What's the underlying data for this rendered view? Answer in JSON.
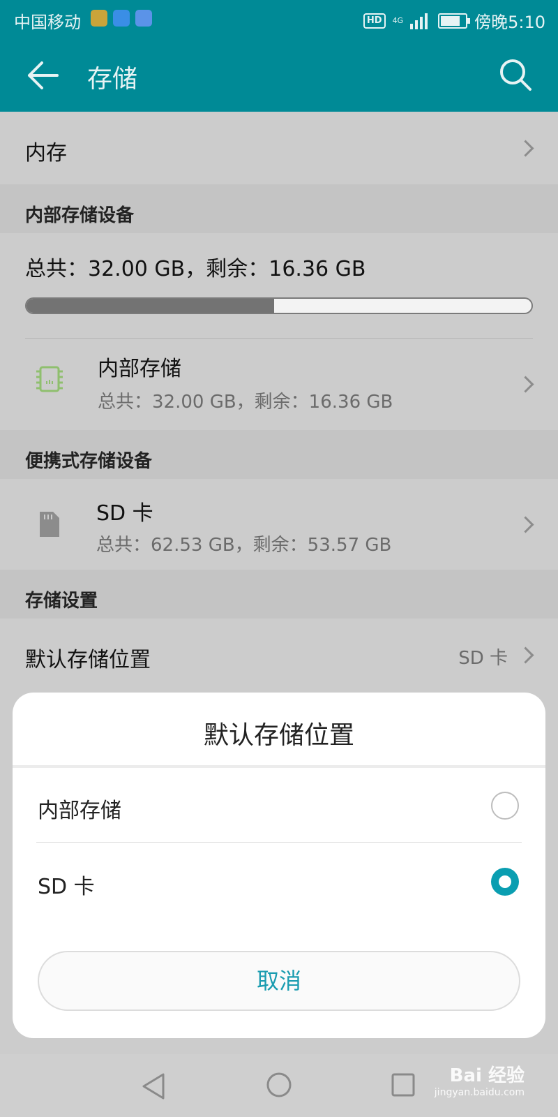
{
  "status_bar": {
    "carrier": "中国移动",
    "network": "4G",
    "hd_badge": "HD",
    "time": "傍晚5:10",
    "battery_level": 0.9
  },
  "app_bar": {
    "title": "存储",
    "back_icon": "arrow-left-icon",
    "search_icon": "search-icon"
  },
  "memory_row": {
    "label": "内存"
  },
  "internal_section": {
    "header": "内部存储设备",
    "summary": "总共：32.00 GB，剩余：16.36 GB",
    "used_fraction": 0.49,
    "item": {
      "icon": "chip-icon",
      "title": "内部存储",
      "detail": "总共：32.00 GB，剩余：16.36 GB"
    }
  },
  "portable_section": {
    "header": "便携式存储设备",
    "item": {
      "icon": "sd-card-icon",
      "title": "SD 卡",
      "detail": "总共：62.53 GB，剩余：53.57 GB"
    }
  },
  "settings_section": {
    "header": "存储设置",
    "default_location": {
      "label": "默认存储位置",
      "value": "SD 卡"
    }
  },
  "dialog": {
    "title": "默认存储位置",
    "options": [
      {
        "label": "内部存储",
        "selected": false
      },
      {
        "label": "SD 卡",
        "selected": true
      }
    ],
    "cancel": "取消"
  },
  "watermark": {
    "brand": "Bai 经验",
    "url": "jingyan.baidu.com"
  },
  "colors": {
    "accent": "#008a96",
    "radio_selected": "#0a9eb1",
    "cancel_text": "#1a9cb0"
  }
}
